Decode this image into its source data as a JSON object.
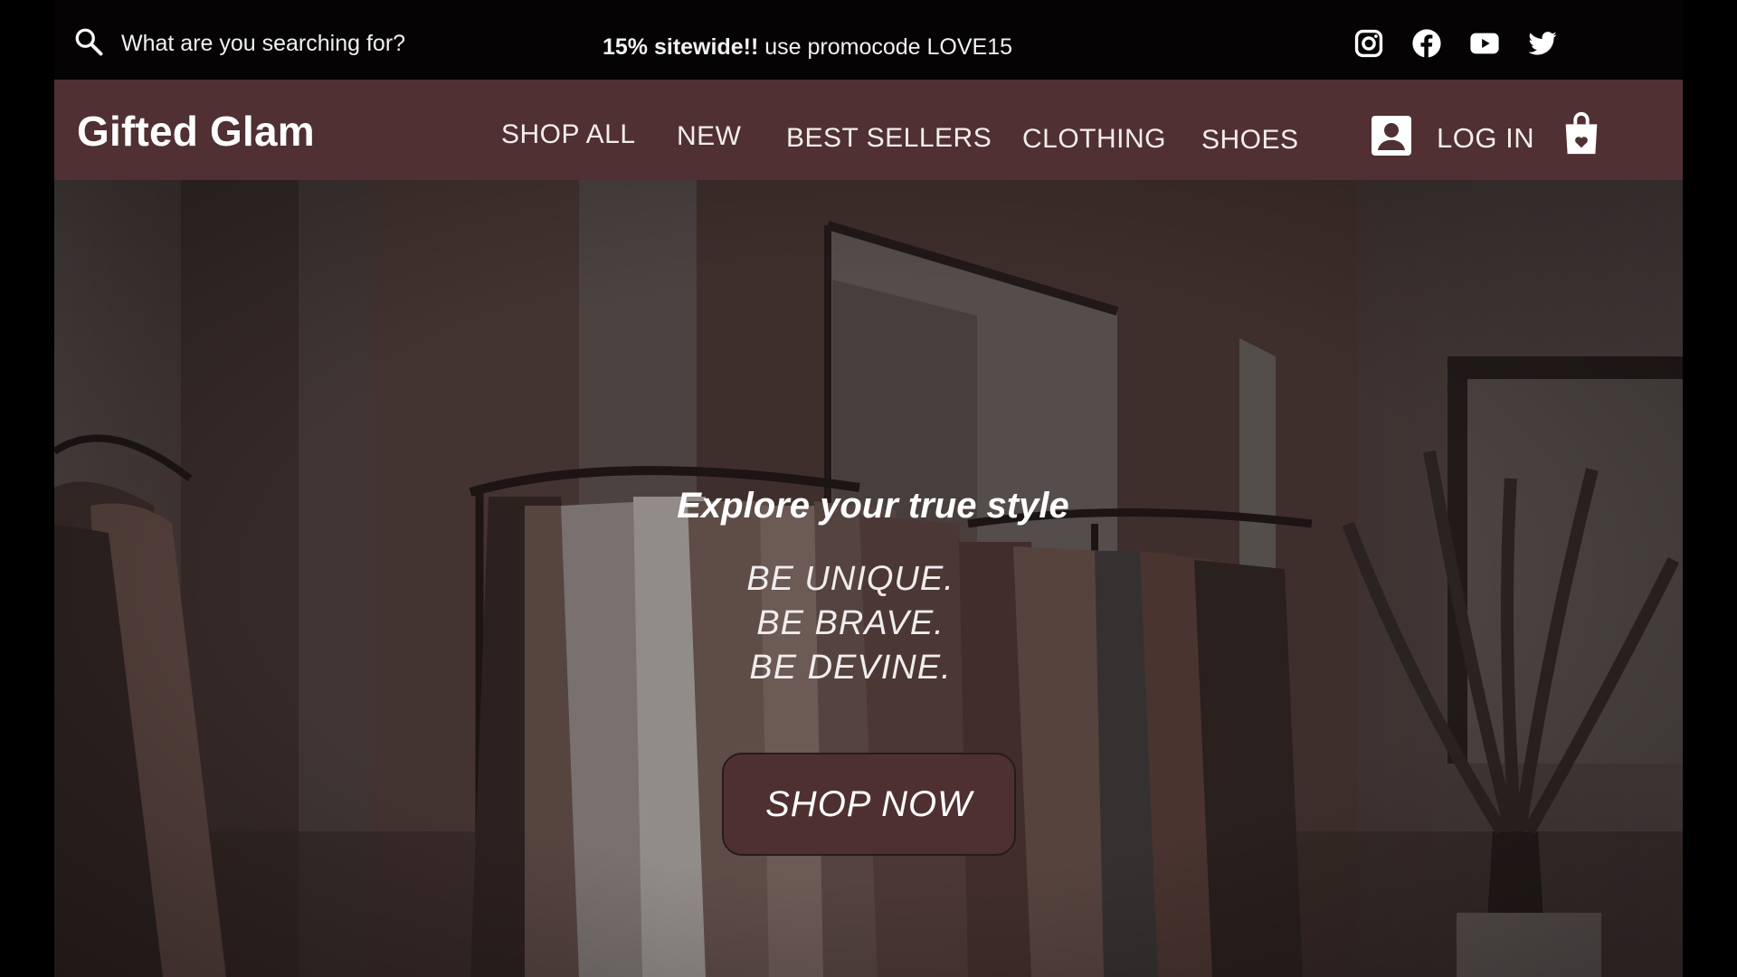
{
  "topbar": {
    "search_placeholder": "What are you searching for?",
    "promo_bold": "15% sitewide!!",
    "promo_rest": " use promocode LOVE15",
    "socials": [
      "instagram-icon",
      "facebook-icon",
      "youtube-icon",
      "twitter-icon"
    ]
  },
  "nav": {
    "logo": "Gifted Glam",
    "links": [
      "SHOP ALL",
      "NEW",
      "BEST SELLERS",
      "CLOTHING",
      "SHOES"
    ],
    "login_label": "LOG IN",
    "icons": {
      "account": "account-icon",
      "bag": "shopping-bag-icon"
    }
  },
  "hero": {
    "title": "Explore your true style",
    "taglines": [
      "BE UNIQUE.",
      "BE BRAVE.",
      "BE DEVINE."
    ],
    "cta": "SHOP NOW"
  },
  "colors": {
    "topbar_bg": "#050303",
    "nav_bg": "#503032",
    "cta_bg": "#4f3031",
    "text": "#ffffff"
  }
}
